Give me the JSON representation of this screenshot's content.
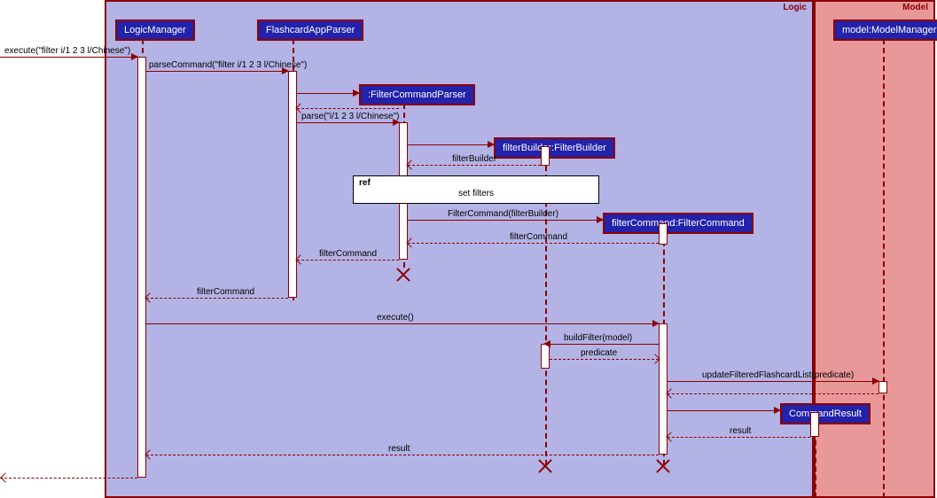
{
  "frames": {
    "logic": {
      "title": "Logic"
    },
    "model": {
      "title": "Model"
    }
  },
  "participants": {
    "logicManager": "LogicManager",
    "flashcardAppParser": "FlashcardAppParser",
    "filterCommandParser": ":FilterCommandParser",
    "filterBuilder": "filterBuilder:FilterBuilder",
    "filterCommand": "filterCommand:FilterCommand",
    "commandResult": "CommandResult",
    "modelManager": "model:ModelManager"
  },
  "messages": {
    "m1": "execute(\"filter i/1 2 3 l/Chinese\")",
    "m2": "parseCommand(\"filter i/1 2 3 l/Chinese\")",
    "m3_return": "",
    "m4": "parse(\"i/1 2 3 l/Chinese\")",
    "m5_return": "filterBuilder",
    "ref1": "set filters",
    "m6": "FilterCommand(filterBuilder)",
    "m6_return": "filterCommand",
    "m7_return": "filterCommand",
    "m8_return": "filterCommand",
    "m9": "execute()",
    "m10": "buildFilter(model)",
    "m10_return": "predicate",
    "m11": "updateFilteredFlashcardList(predicate)",
    "m12_return": "result",
    "m13_return": "result",
    "m14_return": ""
  },
  "ref_keyword": "ref"
}
